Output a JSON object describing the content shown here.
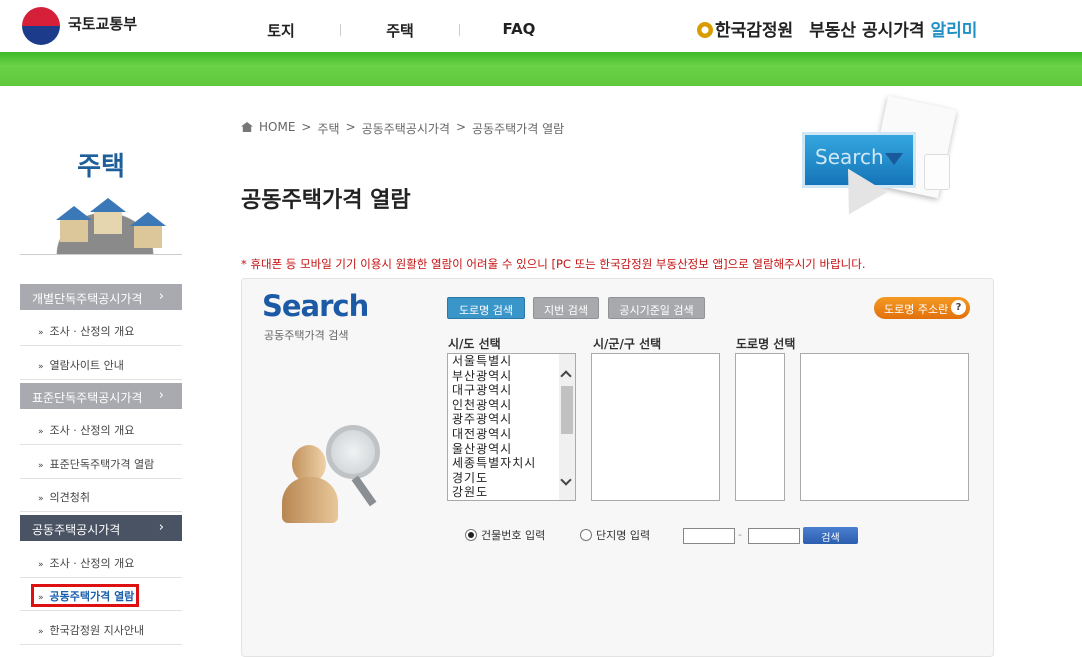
{
  "header": {
    "org_name": "국토교통부",
    "nav": [
      "토지",
      "주택",
      "FAQ"
    ],
    "brand_agency": "한국감정원",
    "brand_service": "부동산 공시가격",
    "brand_highlight": "알리미"
  },
  "sidebar": {
    "title": "주택",
    "sections": [
      {
        "label": "개별단독주택공시가격",
        "chevron": "›",
        "items": [
          "조사 · 산정의 개요",
          "열람사이트 안내"
        ]
      },
      {
        "label": "표준단독주택공시가격",
        "chevron": "›",
        "items": [
          "조사 · 산정의 개요",
          "표준단독주택가격 열람",
          "의견청취"
        ]
      },
      {
        "label": "공동주택공시가격",
        "chevron": "›",
        "items": [
          "조사 · 산정의 개요",
          "공동주택가격 열람",
          "한국감정원 지사안내"
        ]
      }
    ],
    "bullet": "»"
  },
  "breadcrumb": [
    "HOME",
    "주택",
    "공동주택공시가격",
    "공동주택가격 열람"
  ],
  "breadcrumb_sep": ">",
  "page_title": "공동주택가격 열람",
  "hero_text": "Search",
  "notice": "* 휴대폰 등 모바일 기기 이용시 원활한 열람이 어려울 수 있으니 [PC 또는 한국감정원 부동산정보 앱]으로 열람해주시기 바랍니다.",
  "search": {
    "logo": "Search",
    "subtitle": "공동주택가격 검색",
    "tabs": [
      "도로명 검색",
      "지번 검색",
      "공시기준일 검색"
    ],
    "active_tab": 0,
    "addr_button": "도로명 주소란",
    "addr_button_icon": "?",
    "columns": {
      "sido": "시/도 선택",
      "sigungu": "시/군/구 선택",
      "road": "도로명 선택"
    },
    "sido_options": [
      "서울특별시",
      "부산광역시",
      "대구광역시",
      "인천광역시",
      "광주광역시",
      "대전광역시",
      "울산광역시",
      "세종특별자치시",
      "경기도",
      "강원도"
    ],
    "radio_building": "건물번호 입력",
    "radio_complex": "단지명 입력",
    "dash": "-",
    "search_button": "검색"
  },
  "colors": {
    "green": "#5fc83b",
    "blue_title": "#1e5f9a",
    "notice_red": "#c41010",
    "orange": "#e2700d",
    "active_tab": "#3a95c9"
  }
}
